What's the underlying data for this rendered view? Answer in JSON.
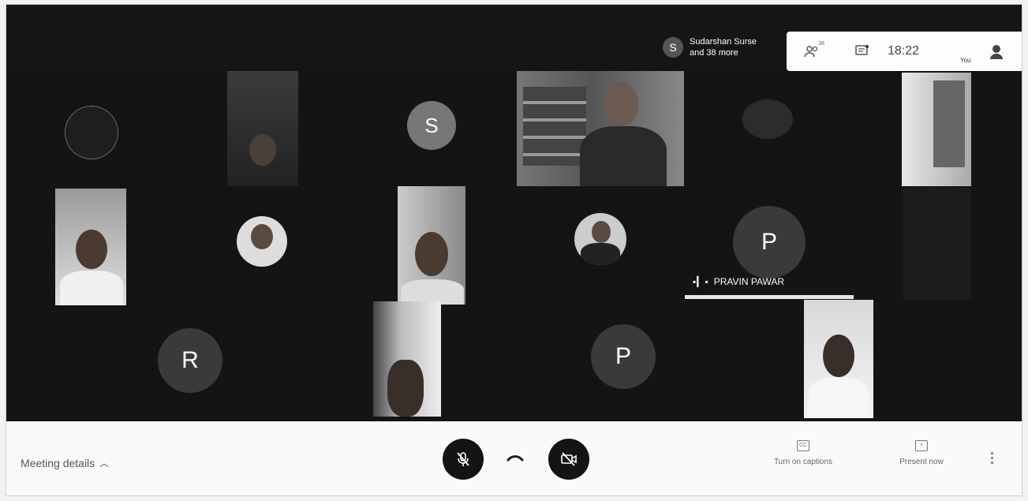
{
  "participants_chip": {
    "avatar_letter": "S",
    "line1": "Sudarshan Surse",
    "line2": "and 38 more"
  },
  "topbar": {
    "people_count": "38",
    "time": "18:22",
    "you_label": "You"
  },
  "tiles": {
    "avatar_s": "S",
    "avatar_p1": "P",
    "avatar_r": "R",
    "avatar_p2": "P",
    "speaker_name": "PRAVIN PAWAR"
  },
  "bottombar": {
    "meeting_details": "Meeting details",
    "captions_label": "Turn on captions",
    "present_label": "Present now"
  }
}
